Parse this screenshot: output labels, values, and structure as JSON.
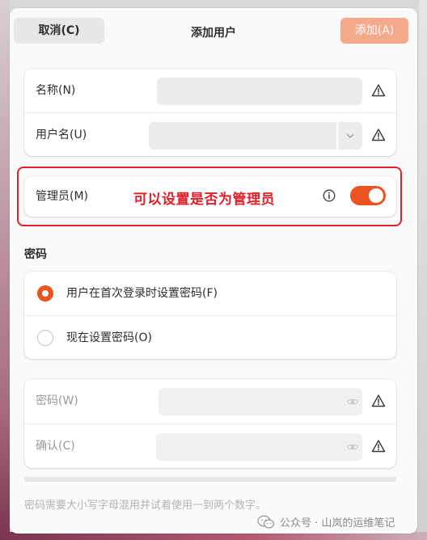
{
  "header": {
    "cancel_label": "取消(C)",
    "title": "添加用户",
    "add_label": "添加(A)"
  },
  "identity": {
    "name_label": "名称(N)",
    "username_label": "用户名(U)",
    "name_value": "",
    "username_value": ""
  },
  "admin": {
    "label": "管理员(M)",
    "enabled": true
  },
  "annotation": "可以设置是否为管理员",
  "password_section": {
    "title": "密码",
    "options": [
      {
        "label": "用户在首次登录时设置密码(F)",
        "selected": true
      },
      {
        "label": "现在设置密码(O)",
        "selected": false
      }
    ],
    "password_label": "密码(W)",
    "confirm_label": "确认(C)",
    "hint": "密码需要大小写字母混用并试着使用一到两个数字。"
  },
  "watermark": "公众号 · 山岚的运维笔记",
  "colors": {
    "accent": "#e95420",
    "add_button": "#f4a98c",
    "annotation": "#e0202a"
  },
  "icons": {
    "warning": "warning-icon",
    "info": "info-icon",
    "eye": "eye-icon",
    "dropdown": "chevron-down-icon"
  }
}
